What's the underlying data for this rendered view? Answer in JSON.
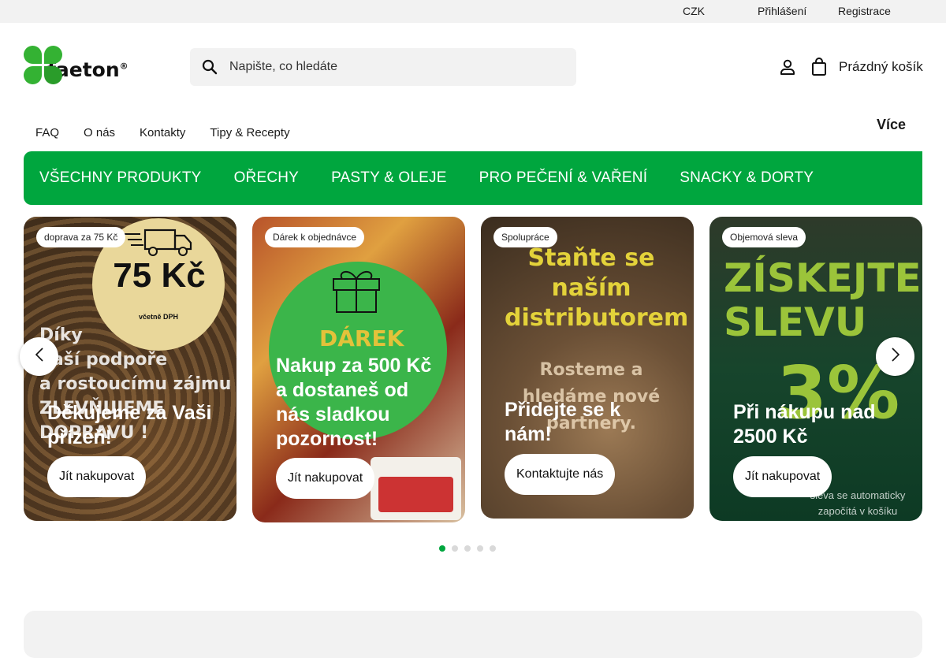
{
  "topbar": {
    "currency": "CZK",
    "currency_chevron": "",
    "login": "Přihlášení",
    "register": "Registrace"
  },
  "header": {
    "logo_text": "faeton",
    "logo_reg": "®",
    "search": {
      "placeholder": "Napište, co hledáte",
      "value": ""
    },
    "account_icon": "user-icon",
    "cart_label": "Prázdný košík"
  },
  "subnav": {
    "items": [
      "FAQ",
      "O nás",
      "Kontakty",
      "Tipy & Recepty"
    ],
    "more_label": "Více",
    "more_chevron": ""
  },
  "categories": [
    "VŠECHNY PRODUKTY",
    "OŘECHY",
    "PASTY & OLEJE",
    "PRO PEČENÍ & VAŘENÍ",
    "SNACKY & DORTY"
  ],
  "colors": {
    "brand_green": "#00a63e",
    "logo_green": "#34b233"
  },
  "carousel": {
    "slides": [
      {
        "badge": "doprava za 75 Kč",
        "image_text_big": "75 Kč",
        "image_text_small": "včetně DPH",
        "image_text_lines": "Díky\nVaší podpoře\na rostoucímu zájmu\nZLEVŇUJEME DOPRAVU !",
        "title": "Děkujeme za Vaši přízeň!",
        "cta": "Jít nakupovat"
      },
      {
        "badge": "Dárek k objednávce",
        "image_text": "DÁREK",
        "title": "Nakup za 500 Kč a dostaneš od nás sladkou pozornost!",
        "cta": "Jít nakupovat"
      },
      {
        "badge": "Spolupráce",
        "image_text": "Staňte se naším distributorem",
        "image_text_2": "Rosteme a hledáme nové partnery.",
        "title": "Přidejte se k nám!",
        "cta": "Kontaktujte nás"
      },
      {
        "badge": "Objemová sleva",
        "image_text": "ZÍSKEJTE SLEVU",
        "image_pct": "3%",
        "image_note": "sleva se automaticky započítá v košíku",
        "title": "Při nákupu nad 2500 Kč",
        "cta": "Jít nakupovat"
      }
    ],
    "dots_total": 5,
    "active_dot": 1
  }
}
